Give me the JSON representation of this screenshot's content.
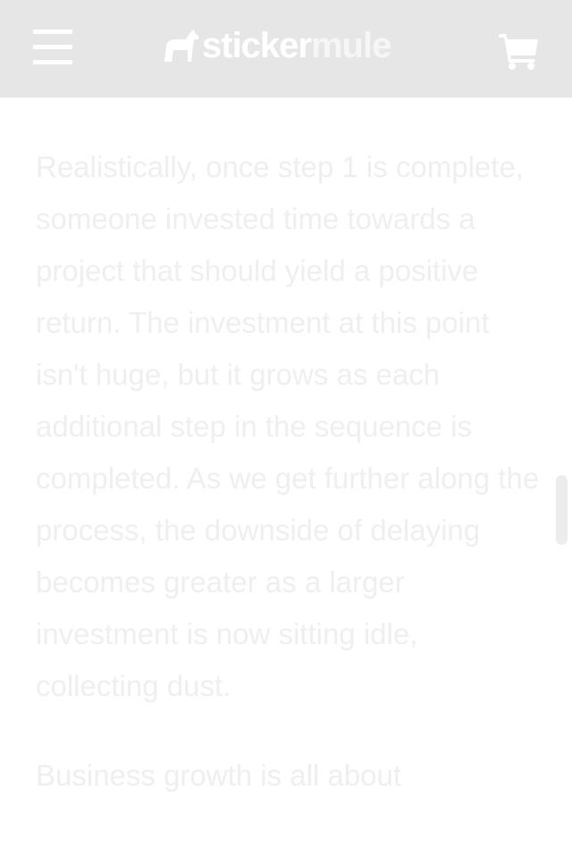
{
  "header": {
    "logo": {
      "part1": "sticker",
      "part2": "mule"
    },
    "menu_icon": "hamburger-menu-icon",
    "cart_icon": "shopping-cart-icon"
  },
  "article": {
    "paragraphs": [
      "Realistically, once step 1 is complete, someone invested time towards a project that should yield a positive return. The investment at this point isn't huge, but it grows as each additional step in the sequence is completed. As we get further along the process, the downside of delaying becomes greater as a larger investment is now sitting idle, collecting dust.",
      "Business growth is all about"
    ]
  },
  "colors": {
    "header_bg": "#e6e6e6",
    "header_fg": "#ffffff",
    "text": "#efefef"
  }
}
